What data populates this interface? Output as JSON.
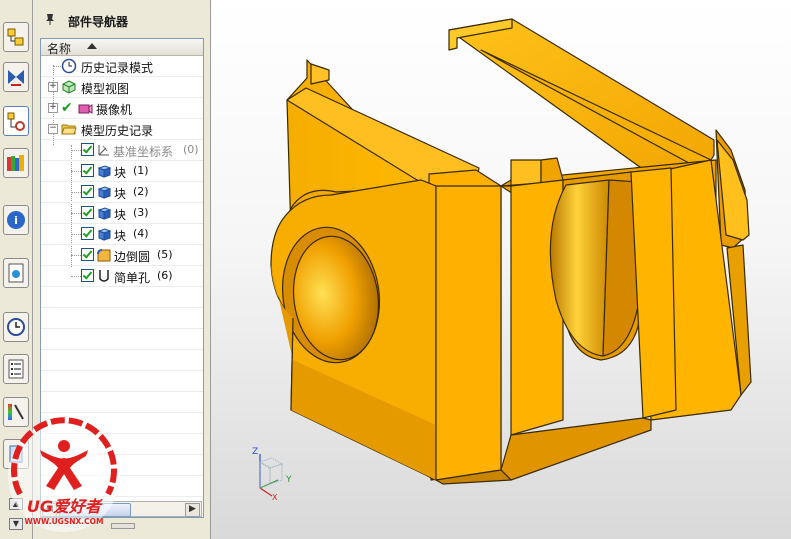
{
  "navigator": {
    "title": "部件导航器",
    "column_header": "名称",
    "items": [
      {
        "label": "历史记录模式",
        "number": ""
      },
      {
        "label": "模型视图",
        "number": ""
      },
      {
        "label": "摄像机",
        "number": ""
      },
      {
        "label": "模型历史记录",
        "number": ""
      },
      {
        "label": "基准坐标系",
        "number": "(0)"
      },
      {
        "label": "块",
        "number": "(1)"
      },
      {
        "label": "块",
        "number": "(2)"
      },
      {
        "label": "块",
        "number": "(3)"
      },
      {
        "label": "块",
        "number": "(4)"
      },
      {
        "label": "边倒圆",
        "number": "(5)"
      },
      {
        "label": "简单孔",
        "number": "(6)"
      }
    ]
  },
  "triad": {
    "z": "Z",
    "y": "Y",
    "x": "X"
  },
  "watermark": {
    "brand": "UG爱好者",
    "url": "WWW.UGSNX.COM"
  },
  "colors": {
    "part": "#ffb400",
    "part_dark": "#d98c00",
    "part_edge": "#3a2a00",
    "checkbox": "#21a121"
  }
}
